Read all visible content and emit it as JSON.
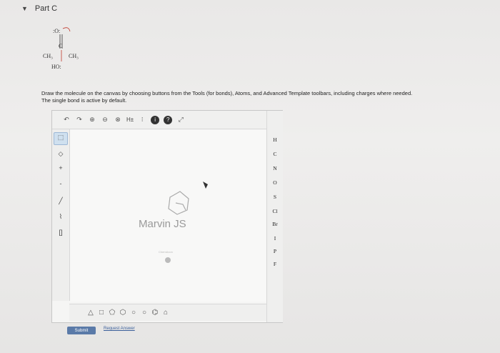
{
  "part": {
    "title": "Part C"
  },
  "molecule": {
    "top_oxygen": ":O:",
    "carbon": "C",
    "left_group": "CH₃",
    "right_group": "CH₃",
    "hydroxyl": "HO:"
  },
  "instructions": {
    "line1": "Draw the molecule on the canvas by choosing buttons from the Tools (for bonds), Atoms, and Advanced Template toolbars, including charges where needed.",
    "line2": "The single bond is active by default."
  },
  "editor": {
    "watermark": "Marvin JS",
    "watermark_sub": "ChemAxon",
    "top_toolbar": {
      "hs_label": "H±",
      "info": "i",
      "help": "?"
    },
    "left_tools": [
      "select",
      "erase",
      "plus",
      "minus",
      "bond",
      "chain",
      "bracket"
    ],
    "atoms": [
      "H",
      "C",
      "N",
      "O",
      "S",
      "Cl",
      "Br",
      "I",
      "P",
      "F"
    ],
    "bottom_shapes": [
      "triangle",
      "square",
      "pentagon",
      "hexagon",
      "heptagon",
      "octagon",
      "benzene",
      "custom"
    ]
  },
  "actions": {
    "submit_label": "Submit",
    "request_label": "Request Answer"
  }
}
